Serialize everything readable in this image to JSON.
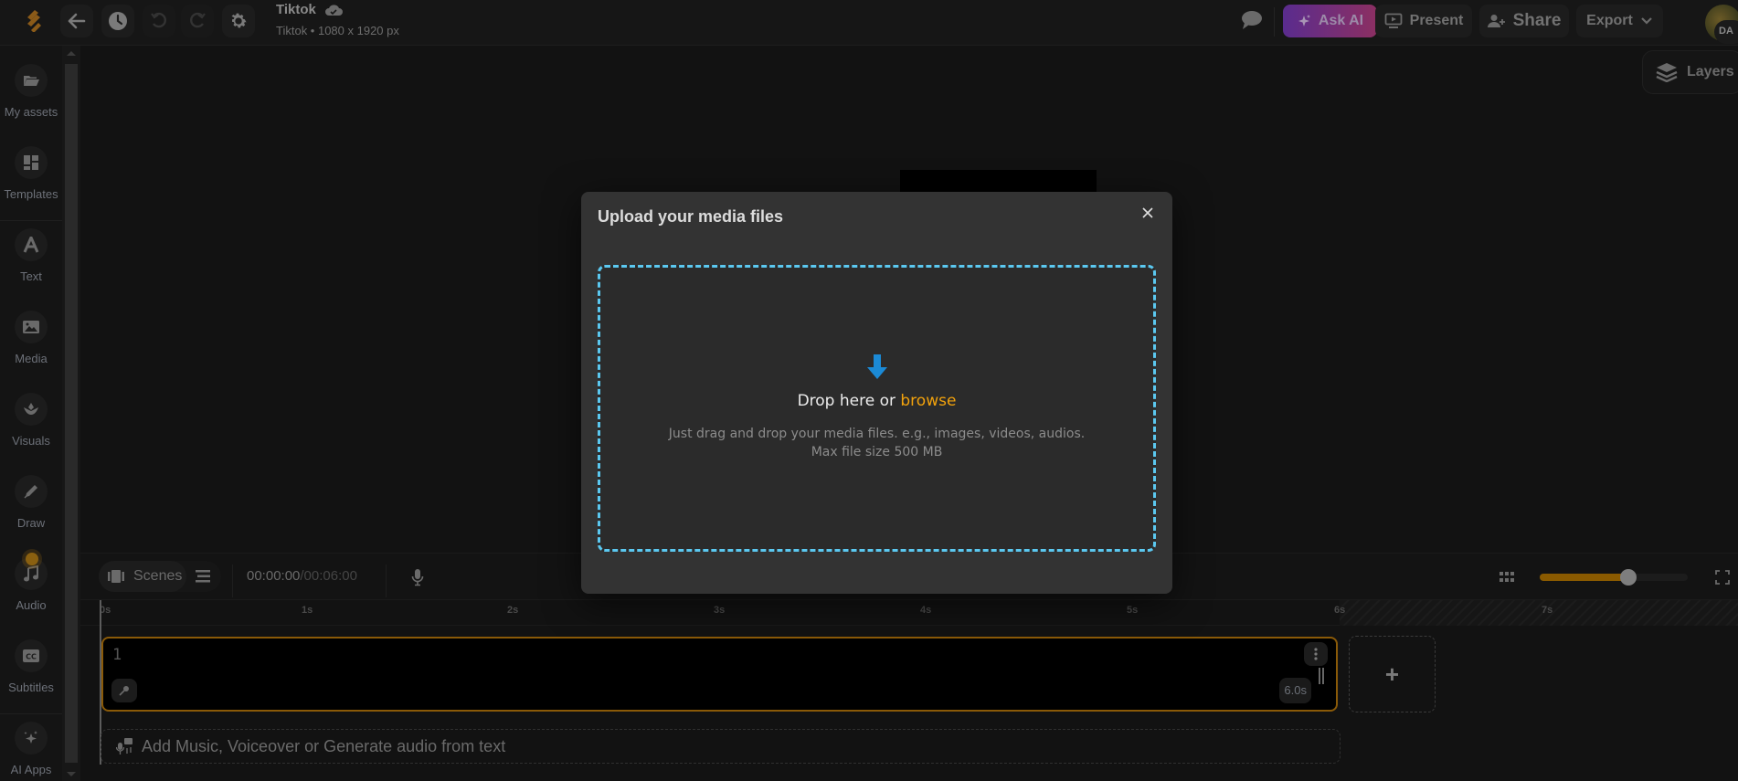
{
  "header": {
    "doc_title": "Tiktok",
    "doc_subtitle": "Tiktok • 1080 x 1920 px",
    "ask_ai_label": "Ask AI",
    "present_label": "Present",
    "share_label": "Share",
    "export_label": "Export",
    "avatar_initials": "DA"
  },
  "sidebar": {
    "items": [
      {
        "label": "My assets",
        "icon": "folder-open-icon"
      },
      {
        "label": "Templates",
        "icon": "templates-icon"
      },
      {
        "label": "Text",
        "icon": "text-icon"
      },
      {
        "label": "Media",
        "icon": "image-icon"
      },
      {
        "label": "Visuals",
        "icon": "visuals-icon"
      },
      {
        "label": "Draw",
        "icon": "pen-icon"
      },
      {
        "label": "Audio",
        "icon": "music-icon"
      },
      {
        "label": "Subtitles",
        "icon": "cc-icon"
      },
      {
        "label": "AI Apps",
        "icon": "sparkles-icon"
      }
    ]
  },
  "canvas": {
    "layers_label": "Layers"
  },
  "timeline": {
    "scenes_label": "Scenes",
    "current_time": "00:00:00",
    "total_time": "/00:06:00",
    "zoom_level_fraction": 0.6,
    "ruler_ticks": [
      "0s",
      "1s",
      "2s",
      "3s",
      "4s",
      "5s",
      "6s",
      "7s"
    ],
    "scene": {
      "number": "1",
      "duration": "6.0s"
    },
    "add_scene_label": "+",
    "audio_track_label": "Add Music, Voiceover or Generate audio from text"
  },
  "modal": {
    "title": "Upload your media files",
    "drop_text": "Drop here or ",
    "browse_label": "browse",
    "description_line1": "Just drag and drop your media files. e.g., images, videos, audios.",
    "description_line2": "Max file size 500 MB"
  },
  "colors": {
    "accent_orange": "#f2a20c",
    "dropzone_border": "#5bc8f0",
    "scene_border": "#8a5a08",
    "download_arrow": "#1b8ad6"
  }
}
